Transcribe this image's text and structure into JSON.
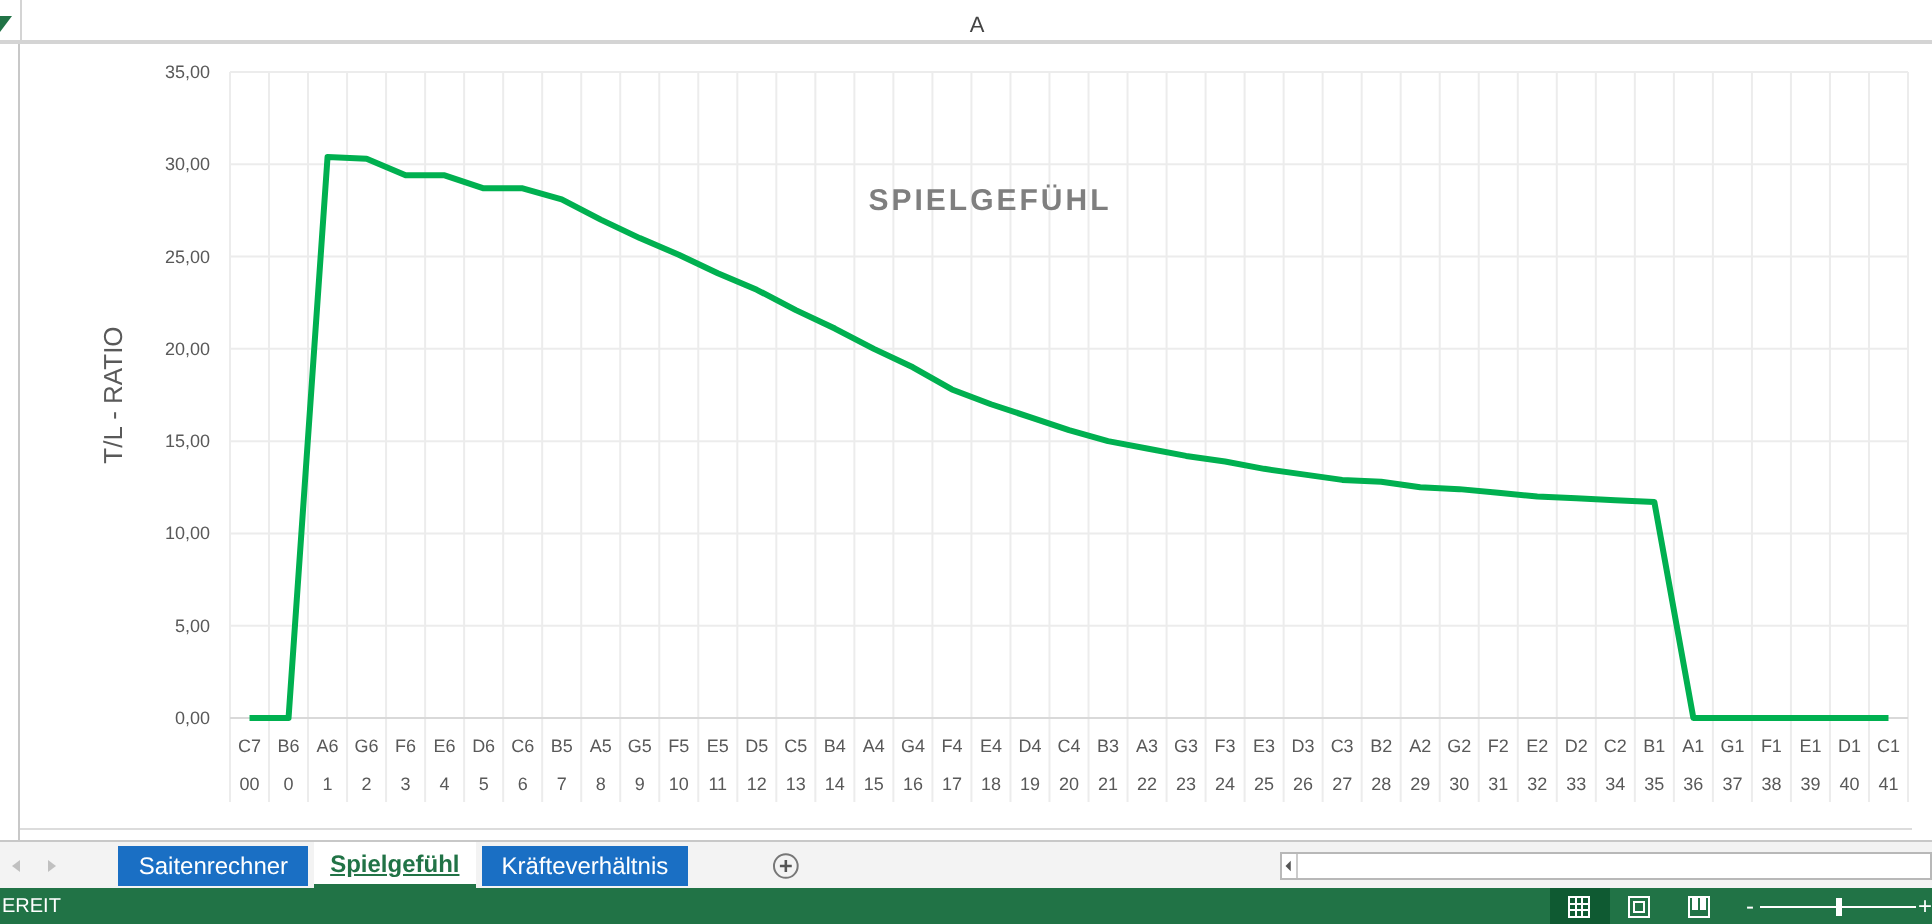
{
  "column_header": {
    "label": "A"
  },
  "chart": {
    "chart_data": {
      "type": "line",
      "title": "SPIELGEFÜHL",
      "ylabel": "T/L - RATIO",
      "categories": [
        [
          "C7",
          "00"
        ],
        [
          "B6",
          "0"
        ],
        [
          "A6",
          "1"
        ],
        [
          "G6",
          "2"
        ],
        [
          "F6",
          "3"
        ],
        [
          "E6",
          "4"
        ],
        [
          "D6",
          "5"
        ],
        [
          "C6",
          "6"
        ],
        [
          "B5",
          "7"
        ],
        [
          "A5",
          "8"
        ],
        [
          "G5",
          "9"
        ],
        [
          "F5",
          "10"
        ],
        [
          "E5",
          "11"
        ],
        [
          "D5",
          "12"
        ],
        [
          "C5",
          "13"
        ],
        [
          "B4",
          "14"
        ],
        [
          "A4",
          "15"
        ],
        [
          "G4",
          "16"
        ],
        [
          "F4",
          "17"
        ],
        [
          "E4",
          "18"
        ],
        [
          "D4",
          "19"
        ],
        [
          "C4",
          "20"
        ],
        [
          "B3",
          "21"
        ],
        [
          "A3",
          "22"
        ],
        [
          "G3",
          "23"
        ],
        [
          "F3",
          "24"
        ],
        [
          "E3",
          "25"
        ],
        [
          "D3",
          "26"
        ],
        [
          "C3",
          "27"
        ],
        [
          "B2",
          "28"
        ],
        [
          "A2",
          "29"
        ],
        [
          "G2",
          "30"
        ],
        [
          "F2",
          "31"
        ],
        [
          "E2",
          "32"
        ],
        [
          "D2",
          "33"
        ],
        [
          "C2",
          "34"
        ],
        [
          "B1",
          "35"
        ],
        [
          "A1",
          "36"
        ],
        [
          "G1",
          "37"
        ],
        [
          "F1",
          "38"
        ],
        [
          "E1",
          "39"
        ],
        [
          "D1",
          "40"
        ],
        [
          "C1",
          "41"
        ]
      ],
      "grid": true,
      "series": [
        {
          "color": "#00b050",
          "values": [
            0,
            0,
            30.4,
            30.3,
            29.4,
            29.4,
            28.7,
            28.7,
            28.1,
            27.0,
            26.0,
            25.1,
            24.1,
            23.2,
            22.1,
            21.1,
            20.0,
            19.0,
            17.8,
            17.0,
            16.3,
            15.6,
            15.0,
            14.6,
            14.2,
            13.9,
            13.5,
            13.2,
            12.9,
            12.8,
            12.5,
            12.4,
            12.2,
            12.0,
            11.9,
            11.8,
            11.7,
            0,
            0,
            0,
            0,
            0,
            0
          ]
        }
      ],
      "ylim": [
        0,
        35
      ],
      "yticks": [
        {
          "value": 0,
          "label": "0,00"
        },
        {
          "value": 5,
          "label": "5,00"
        },
        {
          "value": 10,
          "label": "10,00"
        },
        {
          "value": 15,
          "label": "15,00"
        },
        {
          "value": 20,
          "label": "20,00"
        },
        {
          "value": 25,
          "label": "25,00"
        },
        {
          "value": 30,
          "label": "30,00"
        },
        {
          "value": 35,
          "label": "35,00"
        }
      ]
    }
  },
  "sheet_tabs": [
    {
      "label": "Saitenrechner",
      "selected": false
    },
    {
      "label": "Spielgefühl",
      "selected": true
    },
    {
      "label": "Kräfteverhältnis",
      "selected": false
    }
  ],
  "status_bar": {
    "text": "EREIT",
    "views": [
      {
        "kind": "normal",
        "selected": true
      },
      {
        "kind": "layout",
        "selected": false
      },
      {
        "kind": "pagebreak",
        "selected": false
      }
    ],
    "zoom": {
      "minus": "-",
      "plus": "+",
      "level": 0.5
    }
  }
}
